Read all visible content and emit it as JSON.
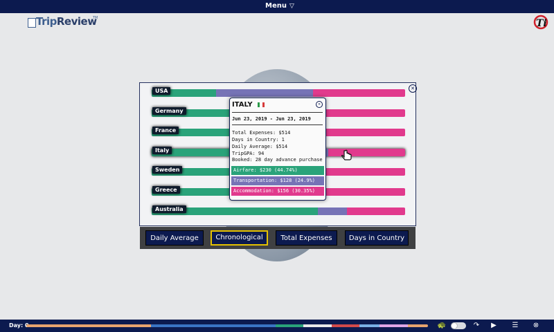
{
  "header": {
    "menu_label": "Menu"
  },
  "logo": {
    "brand_a": "Trip",
    "brand_b": "Review",
    "tm": "TM"
  },
  "countries": [
    {
      "name": "USA",
      "airfare_pct": 25.4,
      "transportation_pct": 38.3,
      "accommodation_pct": 36.3
    },
    {
      "name": "Germany",
      "airfare_pct": 34,
      "transportation_pct": 33,
      "accommodation_pct": 33
    },
    {
      "name": "France",
      "airfare_pct": 35,
      "transportation_pct": 33,
      "accommodation_pct": 32
    },
    {
      "name": "Italy",
      "airfare_pct": 44.74,
      "transportation_pct": 24.9,
      "accommodation_pct": 30.35
    },
    {
      "name": "Sweden",
      "airfare_pct": 34,
      "transportation_pct": 33,
      "accommodation_pct": 33
    },
    {
      "name": "Greece",
      "airfare_pct": 34,
      "transportation_pct": 33,
      "accommodation_pct": 33
    },
    {
      "name": "Australia",
      "airfare_pct": 65.6,
      "transportation_pct": 11.5,
      "accommodation_pct": 22.9
    }
  ],
  "sort_buttons": [
    {
      "label": "Daily Average",
      "active": false
    },
    {
      "label": "Chronological",
      "active": true
    },
    {
      "label": "Total Expenses",
      "active": false
    },
    {
      "label": "Days in Country",
      "active": false
    }
  ],
  "popup": {
    "title": "ITALY",
    "dates": "Jun 23, 2019 - Jun 23, 2019",
    "lines": [
      "Total Expenses: $514",
      "Days in Country: 1",
      "Daily Average: $514",
      "TripGPA: 94",
      "Booked: 28 day advance purchase"
    ],
    "airfare": "Airfare: $230 (44.74%)",
    "transportation": "Transportation: $128 (24.9%)",
    "accommodation": "Accommodation: $156 (30.35%)"
  },
  "footer": {
    "day_label": "Day: 0"
  },
  "colors": {
    "airfare": "#2aa37a",
    "transportation": "#7673b6",
    "accommodation": "#e13a8d",
    "navy": "#0c1a4f",
    "active_border": "#e6c200"
  },
  "timeline_colors": [
    "#e8a46e",
    "#3a74c4",
    "#2aa37a",
    "#e8e8e8",
    "#d24a4a",
    "#7ab0e6",
    "#e0a6e6",
    "#e8a46e"
  ],
  "timeline_fractions": [
    0.31,
    0.31,
    0.07,
    0.07,
    0.07,
    0.05,
    0.07,
    0.05
  ],
  "icons": [
    "turtle-icon",
    "share-arrow-icon",
    "play-icon",
    "list-icon",
    "close-icon",
    "hand-cursor-icon"
  ]
}
